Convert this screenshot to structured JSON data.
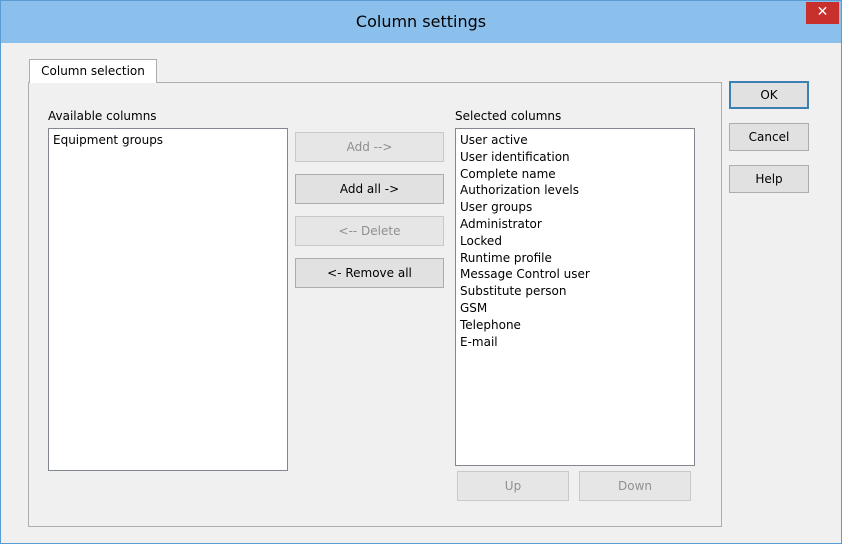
{
  "window": {
    "title": "Column settings",
    "close_label": "✕"
  },
  "tabs": [
    {
      "label": "Column selection"
    }
  ],
  "available": {
    "label": "Available columns",
    "items": [
      "Equipment groups"
    ]
  },
  "selected": {
    "label": "Selected columns",
    "items": [
      "User active",
      "User identification",
      "Complete name",
      "Authorization levels",
      "User groups",
      "Administrator",
      "Locked",
      "Runtime profile",
      "Message Control user",
      "Substitute person",
      "GSM",
      "Telephone",
      "E-mail"
    ]
  },
  "transfer_buttons": {
    "add": "Add -->",
    "add_all": "Add all ->",
    "delete": "<-- Delete",
    "remove_all": "<- Remove all"
  },
  "order_buttons": {
    "up": "Up",
    "down": "Down"
  },
  "dialog_buttons": {
    "ok": "OK",
    "cancel": "Cancel",
    "help": "Help"
  },
  "colors": {
    "titlebar": "#8cc0ec",
    "close": "#c7302c",
    "accent": "#5b9bd5"
  }
}
